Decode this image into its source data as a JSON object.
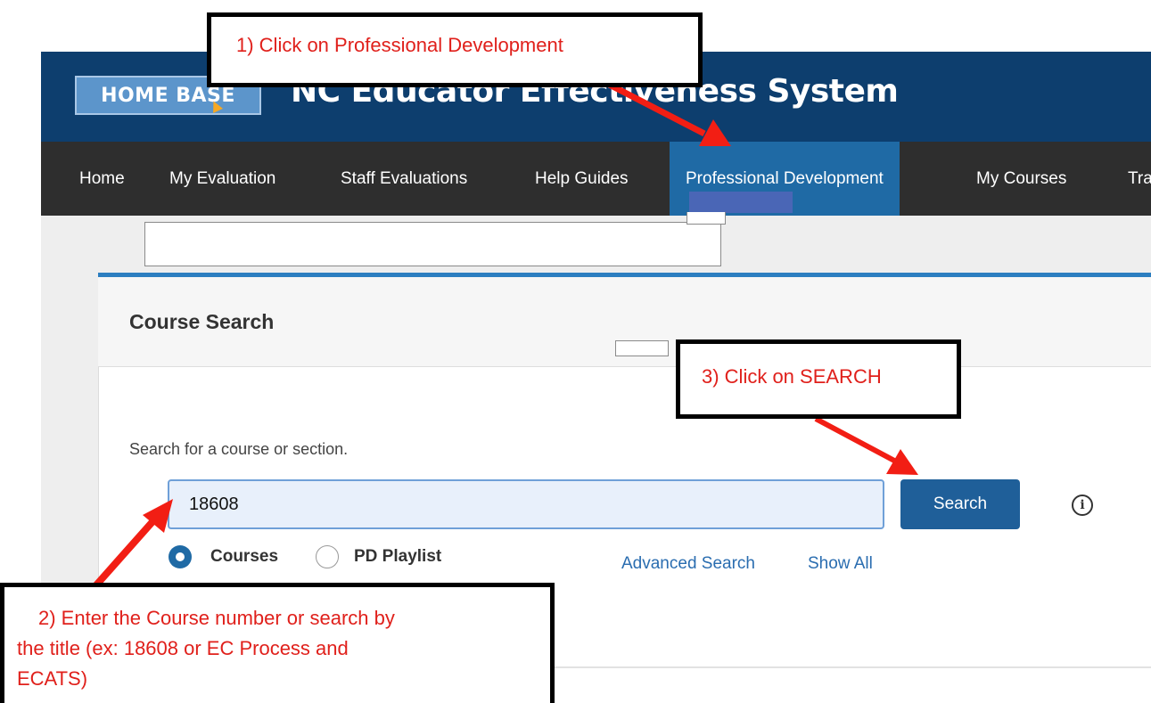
{
  "header": {
    "logo_text": "HOME BASE",
    "system_title": "NC Educator Effectiveness System"
  },
  "nav": {
    "items": [
      {
        "label": "Home"
      },
      {
        "label": "My Evaluation"
      },
      {
        "label": "Staff Evaluations"
      },
      {
        "label": "Help Guides"
      },
      {
        "label": "Professional Development",
        "active": true
      },
      {
        "label": "My Courses"
      },
      {
        "label": "Tra"
      }
    ]
  },
  "course_search": {
    "title": "Course Search",
    "prompt": "Search for a course or section.",
    "input_value": "18608",
    "search_button": "Search",
    "info_icon_glyph": "i",
    "options": [
      {
        "label": "Courses",
        "selected": true
      },
      {
        "label": "PD Playlist",
        "selected": false
      }
    ],
    "links": {
      "advanced_search": "Advanced Search",
      "show_all": "Show All"
    }
  },
  "callouts": {
    "step1": "1) Click on Professional Development",
    "step2_lines": [
      "2) Enter the Course number or search by",
      "the title (ex: 18608 or EC Process and",
      "ECATS)"
    ],
    "step3": "3) Click on SEARCH"
  },
  "colors": {
    "banner": "#0d3e6e",
    "nav": "#2e2e2e",
    "nav_active": "#1f6aa5",
    "accent": "#2c7ec0",
    "annotation_text": "#e0201b",
    "arrow": "#f21e14"
  },
  "icons": {
    "info": "info-circle-icon",
    "radio_selected": "radio-selected-icon",
    "radio_unselected": "radio-unselected-icon"
  }
}
